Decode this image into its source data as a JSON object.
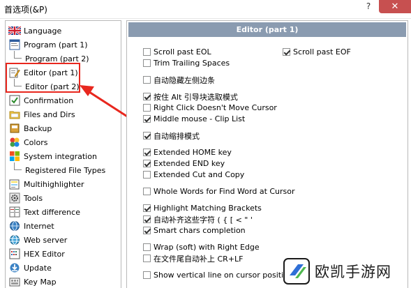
{
  "window": {
    "title": "首选项(&P)",
    "help": "?",
    "close": "✕"
  },
  "sidebar": {
    "items": [
      {
        "label": "Language",
        "icon": "uk-flag-icon"
      },
      {
        "label": "Program  (part 1)",
        "icon": "program-window-icon"
      },
      {
        "label": "Program  (part 2)",
        "icon": ""
      },
      {
        "label": "Editor  (part 1)",
        "icon": "editor-pencil-icon"
      },
      {
        "label": "Editor  (part 2)",
        "icon": ""
      },
      {
        "label": "Confirmation",
        "icon": "confirmation-icon"
      },
      {
        "label": "Files and Dirs",
        "icon": "folder-icon"
      },
      {
        "label": "Backup",
        "icon": "backup-icon"
      },
      {
        "label": "Colors",
        "icon": "colors-icon"
      },
      {
        "label": "System integration",
        "icon": "windows-logo-icon"
      },
      {
        "label": "Registered File Types",
        "icon": ""
      },
      {
        "label": "Multihighlighter",
        "icon": "multihighlighter-icon"
      },
      {
        "label": "Tools",
        "icon": "gear-icon"
      },
      {
        "label": "Text difference",
        "icon": "text-difference-icon"
      },
      {
        "label": "Internet",
        "icon": "internet-icon"
      },
      {
        "label": "Web server",
        "icon": "web-server-icon"
      },
      {
        "label": "HEX Editor",
        "icon": "hex-editor-icon"
      },
      {
        "label": "Update",
        "icon": "update-icon"
      },
      {
        "label": "Key Map",
        "icon": "key-map-icon"
      }
    ]
  },
  "panel": {
    "title": "Editor  (part 1)",
    "options_left": [
      {
        "label": "Scroll past EOL",
        "checked": false
      },
      {
        "label": "Trim Trailing Spaces",
        "checked": false
      },
      {
        "label": "自动隐藏左侧边条",
        "checked": false
      },
      {
        "label": "按住 Alt 引导块选取模式",
        "checked": true
      },
      {
        "label": "Right Click Doesn't Move Cursor",
        "checked": false
      },
      {
        "label": "Middle mouse - Clip List",
        "checked": true
      },
      {
        "label": "自动缩排模式",
        "checked": true
      },
      {
        "label": "Extended HOME key",
        "checked": true
      },
      {
        "label": "Extended END key",
        "checked": true
      },
      {
        "label": "Extended Cut and Copy",
        "checked": false
      },
      {
        "label": "Whole Words for Find Word at Cursor",
        "checked": false
      },
      {
        "label": "Highlight Matching Brackets",
        "checked": true
      },
      {
        "label": "自动补齐这些字符 ( { [ < \" '",
        "checked": true
      },
      {
        "label": "Smart chars completion",
        "checked": true
      },
      {
        "label": "Wrap (soft) with Right Edge",
        "checked": false
      },
      {
        "label": "在文件尾自动补上 CR+LF",
        "checked": false
      },
      {
        "label": "Show vertical line on cursor position",
        "checked": false
      }
    ],
    "options_right": [
      {
        "label": "Scroll past EOF",
        "checked": true
      }
    ]
  },
  "watermark": {
    "text": "欧凯手游网"
  },
  "colors": {
    "header": "#8a9bb0",
    "highlight": "#e8271e"
  }
}
